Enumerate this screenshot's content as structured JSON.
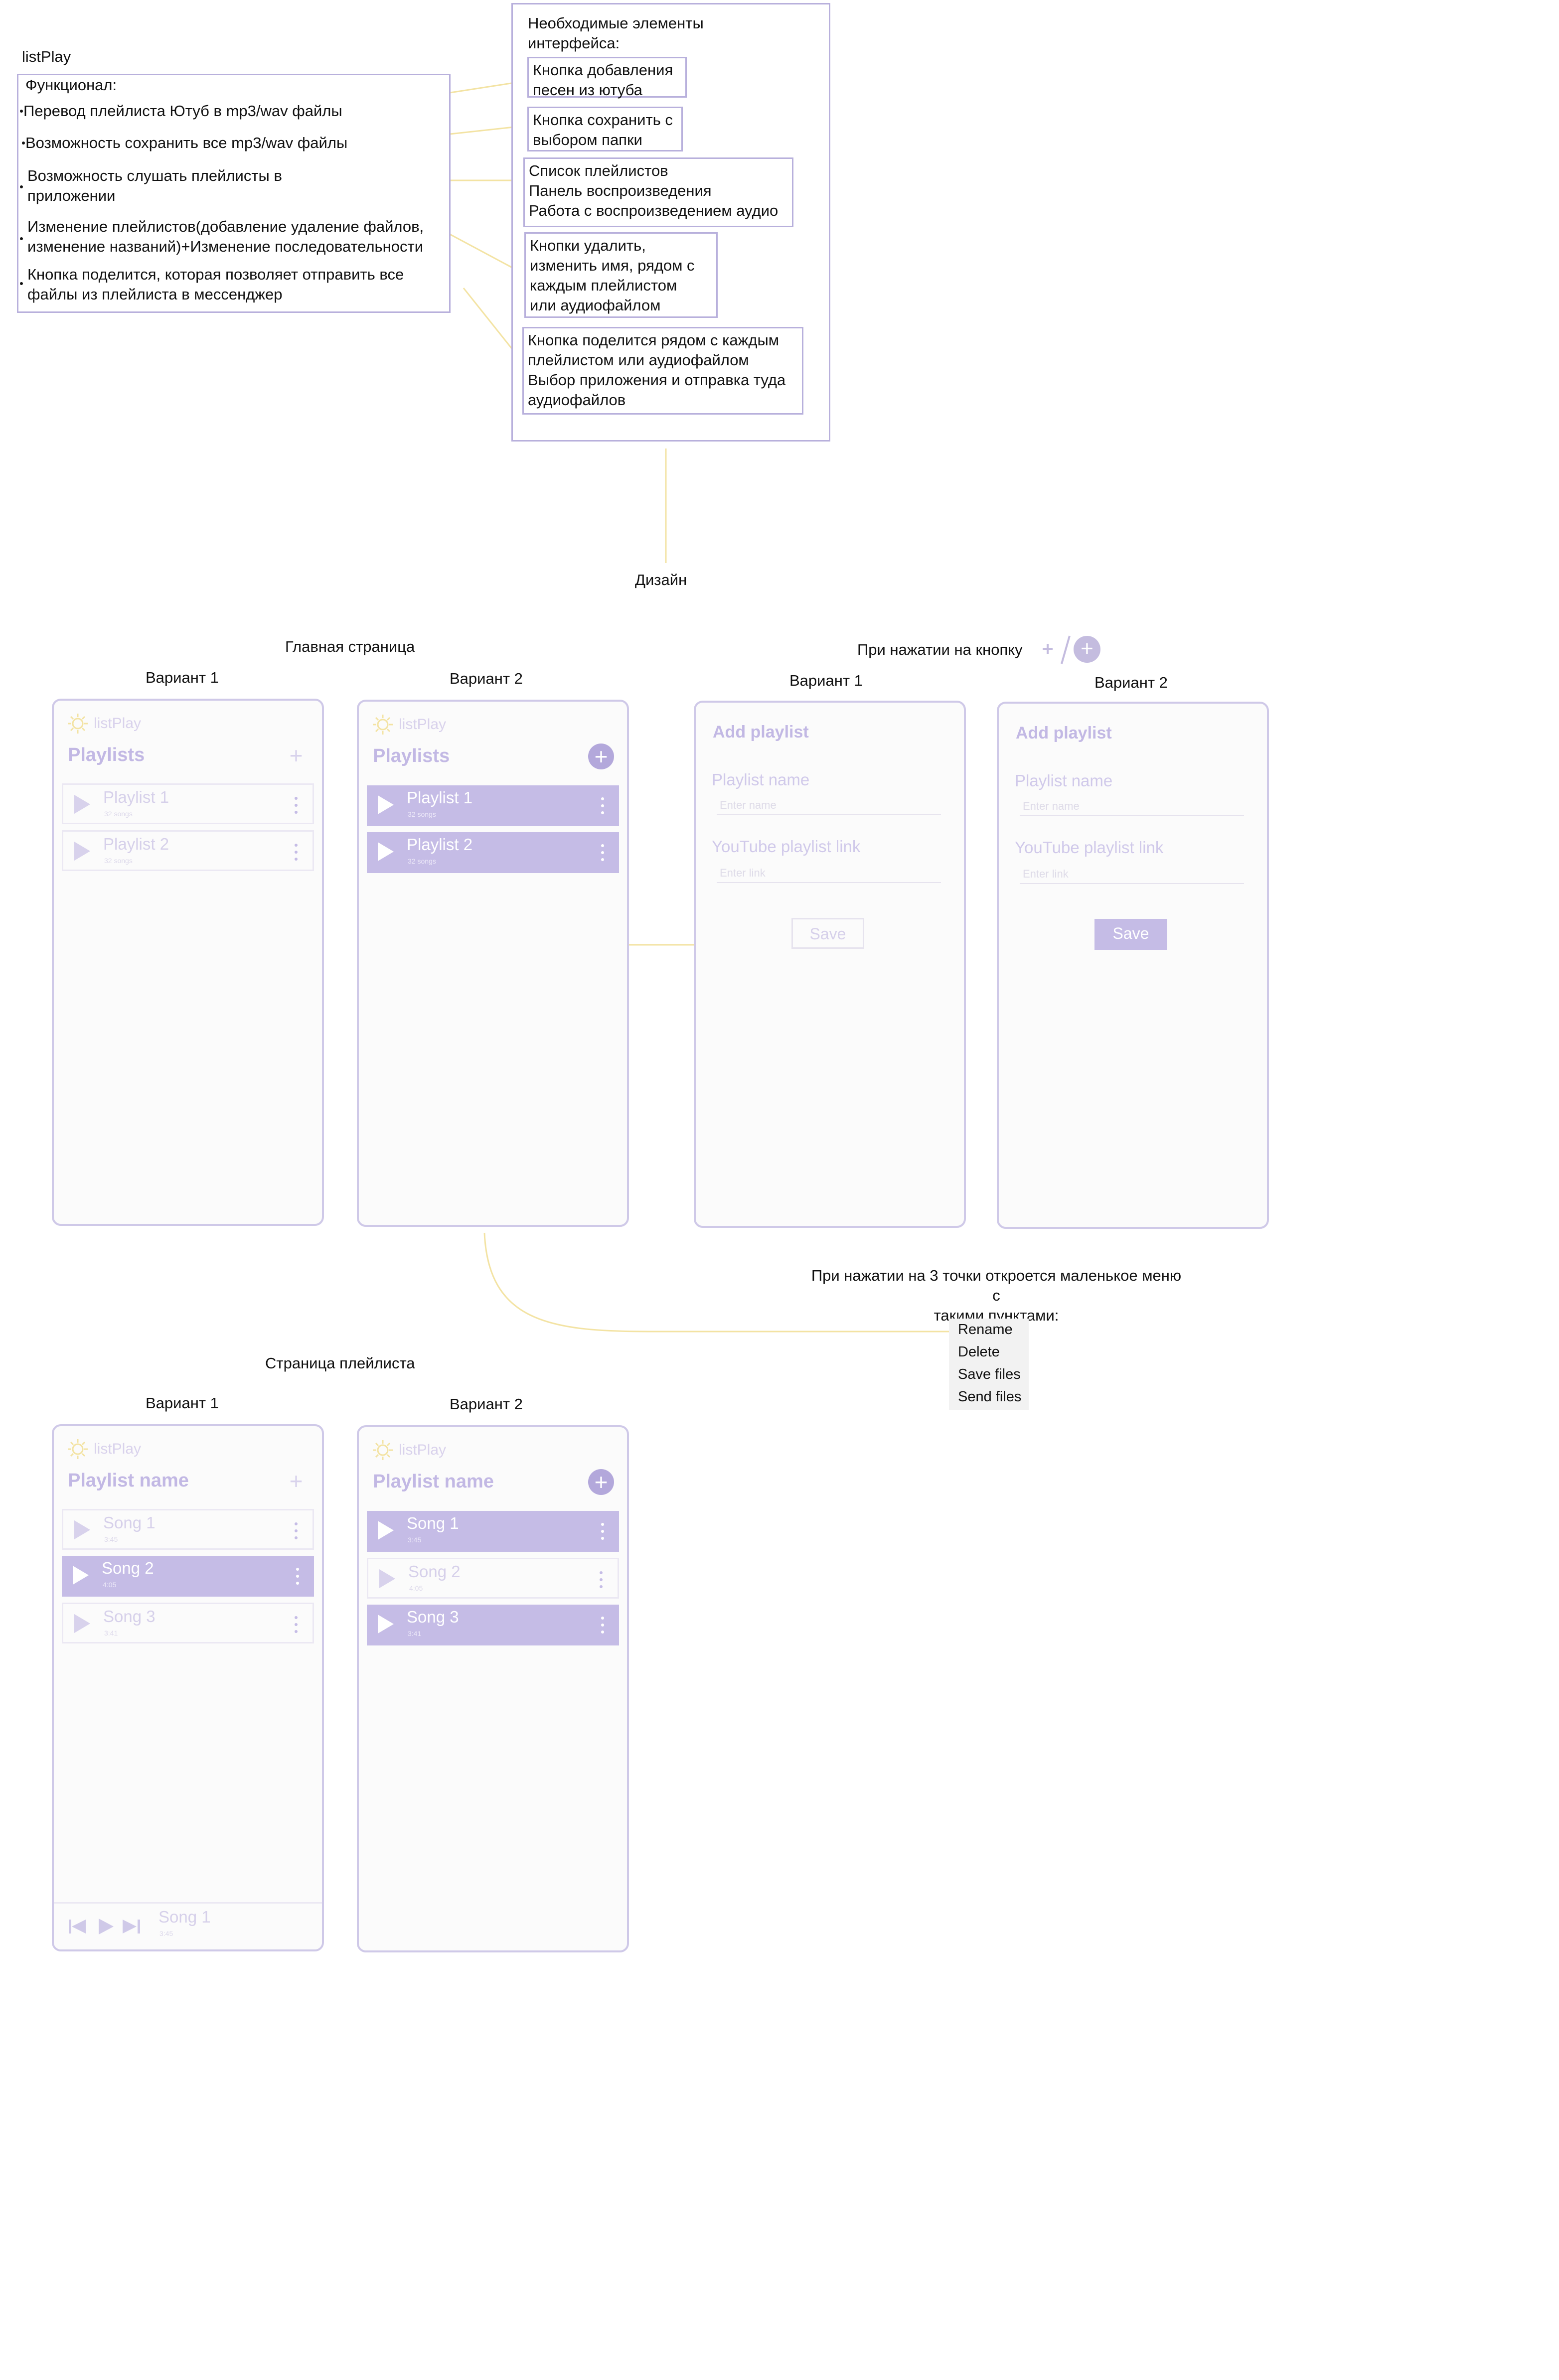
{
  "app_name": "listPlay",
  "functional": {
    "title": "Функционал:",
    "items": [
      "Перевод плейлиста Ютуб в mp3/wav файлы",
      "Возможность сохранить все mp3/wav файлы",
      "Возможность слушать плейлисты в\nприложении",
      "Изменение плейлистов(добавление удаление файлов,\nизменение названий)+Изменение последовательности",
      "Кнопка поделится, которая позволяет отправить все\nфайлы из плейлиста в мессенджер"
    ]
  },
  "interface": {
    "title": "Необходимые элементы\nинтерфейса:",
    "items": [
      "Кнопка добавления\nпесен из ютуба",
      "Кнопка сохранить с\nвыбором папки",
      "Список плейлистов\nПанель воспроизведения\nРабота с воспроизведением аудио",
      "Кнопки удалить,\nизменить имя, рядом с\nкаждым плейлистом\nили аудиофайлом",
      "Кнопка поделится рядом с каждым\nплейлистом или аудиофайлом\nВыбор приложения и отправка туда\nаудиофайлов"
    ]
  },
  "design_label": "Дизайн",
  "main_page_label": "Главная страница",
  "on_button_label": "При нажатии на кнопку",
  "variant1": "Вариант 1",
  "variant2": "Вариант 2",
  "kebab_note": "При нажатии на 3 точки откроется маленькое меню с\nтакими пунктами:",
  "kebab_menu": [
    "Rename",
    "Delete",
    "Save files",
    "Send files"
  ],
  "playlist_page_label": "Страница плейлиста",
  "screens": {
    "playlists_title": "Playlists",
    "playlists": [
      {
        "name": "Playlist 1",
        "sub": "32 songs"
      },
      {
        "name": "Playlist 2",
        "sub": "32 songs"
      }
    ],
    "playlist_name_title": "Playlist name",
    "songs": [
      {
        "name": "Song 1",
        "sub": "3:45"
      },
      {
        "name": "Song 2",
        "sub": "4:05"
      },
      {
        "name": "Song 3",
        "sub": "3:41"
      }
    ],
    "now_playing": {
      "name": "Song 1",
      "sub": "3:45"
    },
    "add_form": {
      "title": "Add playlist",
      "name_label": "Playlist name",
      "name_placeholder": "Enter name",
      "link_label": "YouTube playlist link",
      "link_placeholder": "Enter link",
      "save": "Save"
    }
  },
  "colors": {
    "accent": "#b3a8db",
    "accent_light": "#c5bce6",
    "border": "#cfc9e8",
    "connector": "#f3e3a3"
  }
}
